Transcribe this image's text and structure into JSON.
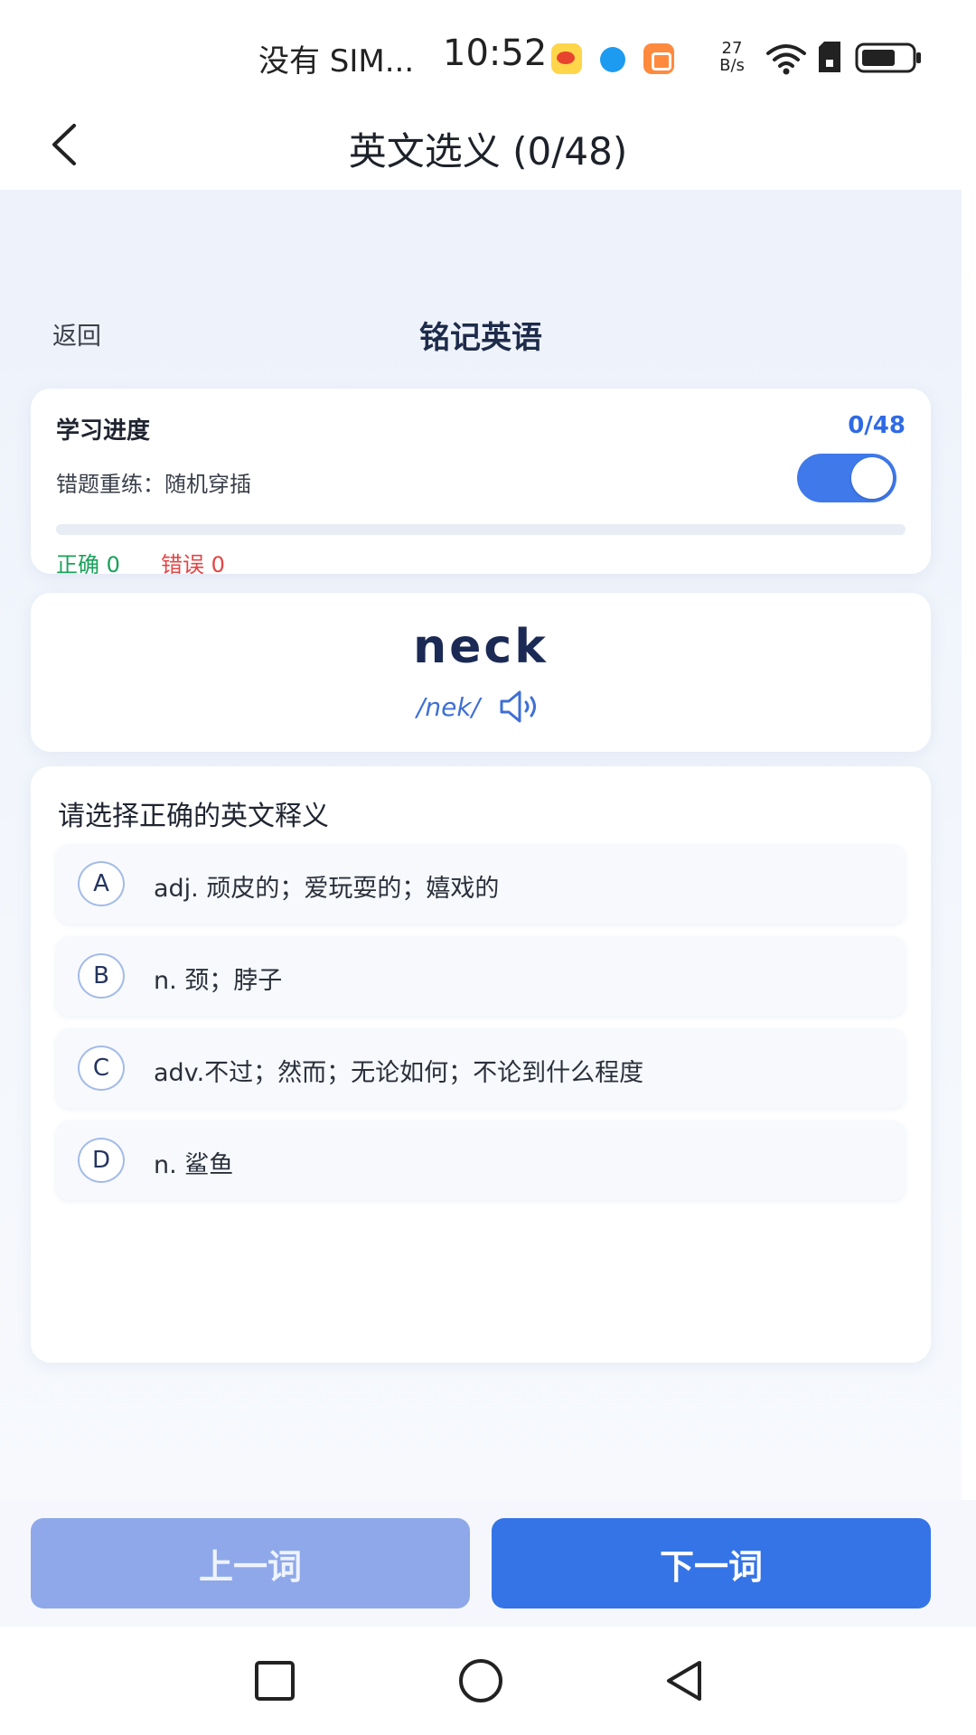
{
  "status_bar": {
    "carrier": "没有 SIM...",
    "time": "10:52",
    "net_speed_value": "27",
    "net_speed_unit": "B/s",
    "icons": [
      "weibo-icon",
      "browser-icon",
      "orange-app-icon",
      "wifi-icon",
      "sd-card-icon",
      "battery-icon"
    ]
  },
  "header": {
    "title": "英文选义 (0/48)",
    "back_icon": "chevron-left-icon"
  },
  "sub_header": {
    "back_label": "返回",
    "app_name": "铭记英语"
  },
  "progress": {
    "title": "学习进度",
    "count": "0/48",
    "retrain_label": "错题重练：随机穿插",
    "retrain_enabled": true,
    "fraction": 0,
    "correct_label": "正确 0",
    "wrong_label": "错误 0"
  },
  "word": {
    "text": "neck",
    "phonetic": "/nek/",
    "speaker_icon": "speaker-icon"
  },
  "question": {
    "prompt": "请选择正确的英文释义",
    "options": [
      {
        "letter": "A",
        "text": "adj. 顽皮的；爱玩耍的；嬉戏的"
      },
      {
        "letter": "B",
        "text": "n. 颈；脖子"
      },
      {
        "letter": "C",
        "text": "adv.不过；然而；无论如何；不论到什么程度"
      },
      {
        "letter": "D",
        "text": "n. 鲨鱼"
      }
    ]
  },
  "buttons": {
    "prev_label": "上一词",
    "next_label": "下一词"
  },
  "colors": {
    "accent": "#3474e6",
    "correct": "#19a15a",
    "wrong": "#e34545",
    "prev_button": "#8ea8e9"
  },
  "system_nav": [
    "recents-square-icon",
    "home-circle-icon",
    "back-triangle-icon"
  ]
}
